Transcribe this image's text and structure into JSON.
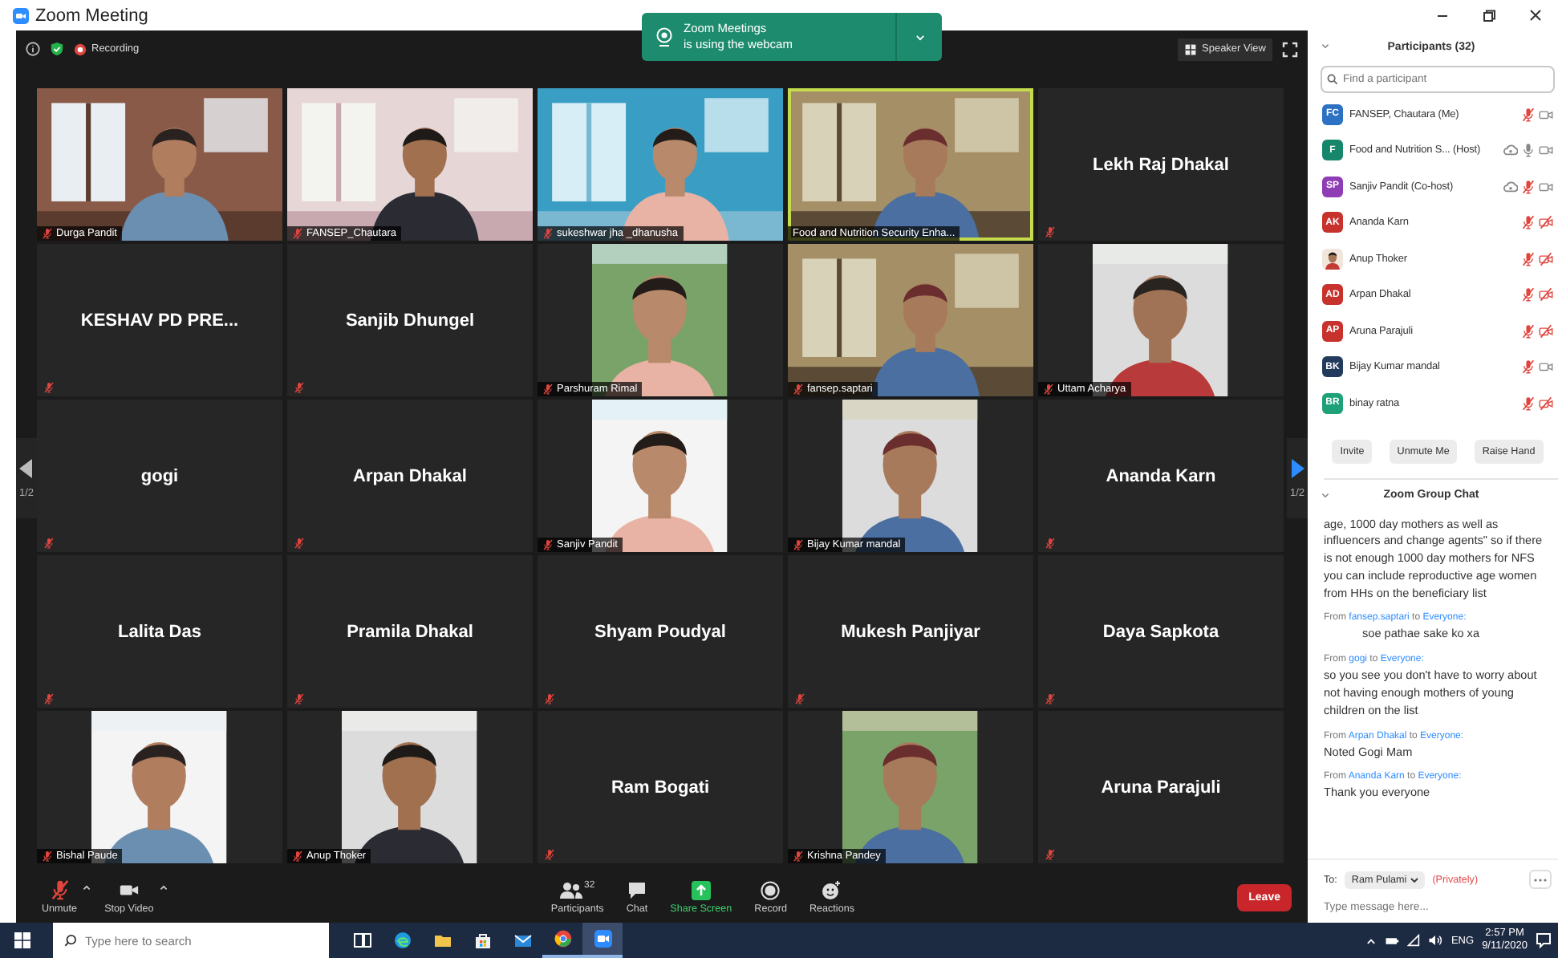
{
  "window": {
    "title": "Zoom Meeting"
  },
  "meeting_bar": {
    "recording": "Recording",
    "view_button": "Speaker View"
  },
  "notification": {
    "title": "Zoom Meetings",
    "message": "is using the webcam"
  },
  "pager": {
    "prev_label": "1/2",
    "next_label": "1/2"
  },
  "tiles": [
    {
      "kind": "video",
      "name": "Durga Pandit",
      "muted": true,
      "speaking": false
    },
    {
      "kind": "video",
      "name": "FANSEP_Chautara",
      "muted": true,
      "speaking": false
    },
    {
      "kind": "video",
      "name": "sukeshwar jha _dhanusha",
      "muted": true,
      "speaking": false
    },
    {
      "kind": "video",
      "name": "Food and Nutrition Security Enha...",
      "muted": false,
      "speaking": true
    },
    {
      "kind": "name",
      "name": "Lekh Raj Dhakal",
      "muted": true,
      "speaking": false
    },
    {
      "kind": "name",
      "name": "KESHAV PD PRE...",
      "muted": true,
      "speaking": false
    },
    {
      "kind": "name",
      "name": "Sanjib Dhungel",
      "muted": true,
      "speaking": false
    },
    {
      "kind": "portrait",
      "name": "Parshuram Rimal",
      "muted": true,
      "speaking": false
    },
    {
      "kind": "video",
      "name": "fansep.saptari",
      "muted": true,
      "speaking": false
    },
    {
      "kind": "portrait",
      "name": "Uttam Acharya",
      "muted": true,
      "speaking": false
    },
    {
      "kind": "name",
      "name": "gogi",
      "muted": true,
      "speaking": false
    },
    {
      "kind": "name",
      "name": "Arpan Dhakal",
      "muted": true,
      "speaking": false
    },
    {
      "kind": "portrait",
      "name": "Sanjiv Pandit",
      "muted": true,
      "speaking": false
    },
    {
      "kind": "portrait",
      "name": "Bijay Kumar mandal",
      "muted": true,
      "speaking": false
    },
    {
      "kind": "name",
      "name": "Ananda Karn",
      "muted": true,
      "speaking": false
    },
    {
      "kind": "name",
      "name": "Lalita Das",
      "muted": true,
      "speaking": false
    },
    {
      "kind": "name",
      "name": "Pramila Dhakal",
      "muted": true,
      "speaking": false
    },
    {
      "kind": "name",
      "name": "Shyam Poudyal",
      "muted": true,
      "speaking": false
    },
    {
      "kind": "name",
      "name": "Mukesh Panjiyar",
      "muted": true,
      "speaking": false
    },
    {
      "kind": "name",
      "name": "Daya Sapkota",
      "muted": true,
      "speaking": false
    },
    {
      "kind": "portrait",
      "name": "Bishal Paude",
      "muted": true,
      "speaking": false
    },
    {
      "kind": "portrait",
      "name": "Anup Thoker",
      "muted": true,
      "speaking": false
    },
    {
      "kind": "name",
      "name": "Ram Bogati",
      "muted": true,
      "speaking": false
    },
    {
      "kind": "portrait",
      "name": "Krishna Pandey",
      "muted": true,
      "speaking": false
    },
    {
      "kind": "name",
      "name": "Aruna Parajuli",
      "muted": true,
      "speaking": false
    }
  ],
  "toolbar": {
    "items": [
      {
        "kind": "mic-muted",
        "label": "Unmute",
        "caret": true
      },
      {
        "kind": "camera",
        "label": "Stop Video",
        "caret": true
      },
      {
        "kind": "participants",
        "label": "Participants",
        "count": "32",
        "caret": false
      },
      {
        "kind": "chat",
        "label": "Chat",
        "caret": false
      },
      {
        "kind": "share",
        "label": "Share Screen",
        "caret": false
      },
      {
        "kind": "record",
        "label": "Record",
        "caret": false
      },
      {
        "kind": "reactions",
        "label": "Reactions",
        "caret": false
      }
    ],
    "leave": "Leave"
  },
  "participants": {
    "title": "Participants (32)",
    "search_placeholder": "Find a participant",
    "people": [
      {
        "kind": "initials",
        "initials": "FC",
        "color": "#2d72c2",
        "name": "FANSEP, Chautara (Me)",
        "recording": false,
        "muted": true,
        "video": true
      },
      {
        "kind": "initials",
        "initials": "F",
        "color": "#17876c",
        "name": "Food and Nutrition S... (Host)",
        "recording": true,
        "muted": false,
        "video": true
      },
      {
        "kind": "initials",
        "initials": "SP",
        "color": "#8e3db4",
        "name": "Sanjiv Pandit (Co-host)",
        "recording": true,
        "muted": true,
        "video": true
      },
      {
        "kind": "initials",
        "initials": "AK",
        "color": "#c8322d",
        "name": "Ananda Karn",
        "recording": false,
        "muted": true,
        "video": false
      },
      {
        "name": "Anup Thoker",
        "recording": false,
        "muted": true,
        "video": false
      },
      {
        "kind": "initials",
        "initials": "AD",
        "color": "#c8322d",
        "name": "Arpan Dhakal",
        "recording": false,
        "muted": true,
        "video": false
      },
      {
        "kind": "initials",
        "initials": "AP",
        "color": "#c8322d",
        "name": "Aruna Parajuli",
        "recording": false,
        "muted": true,
        "video": false
      },
      {
        "kind": "initials",
        "initials": "BK",
        "color": "#233a5c",
        "name": "Bijay Kumar mandal",
        "recording": false,
        "muted": true,
        "video": true
      },
      {
        "kind": "initials",
        "initials": "BR",
        "color": "#1ea079",
        "name": "binay ratna",
        "recording": false,
        "muted": true,
        "video": false
      }
    ],
    "buttons": [
      "Invite",
      "Unmute Me",
      "Raise Hand"
    ]
  },
  "chat": {
    "title": "Zoom Group Chat",
    "messages": [
      {
        "kind": "continuation",
        "text": "age, 1000 day mothers as well as influencers and change agents\" so if there is not enough 1000 day mothers for NFS you can include reproductive age women from HHs on the beneficiary list"
      },
      {
        "kind": "message",
        "from_label": "From",
        "sender": "fansep.saptari",
        "to_label": "to",
        "recipient": "Everyone:",
        "text": "soe pathae sake ko xa",
        "indented": true
      },
      {
        "kind": "message",
        "from_label": "From",
        "sender": "gogi",
        "to_label": "to",
        "recipient": "Everyone:",
        "text": "so you see you don't have to worry about not having enough mothers of young children on the list",
        "indented": false
      },
      {
        "kind": "message",
        "from_label": "From",
        "sender": "Arpan Dhakal",
        "to_label": "to",
        "recipient": "Everyone:",
        "text": "Noted Gogi Mam",
        "indented": false
      },
      {
        "kind": "message",
        "from_label": "From",
        "sender": "Ananda Karn",
        "to_label": "to",
        "recipient": "Everyone:",
        "text": "Thank you everyone",
        "indented": false
      }
    ],
    "to_label": "To:",
    "recipient": "Ram Pulami",
    "privacy": "(Privately)",
    "placeholder": "Type message here..."
  },
  "taskbar": {
    "search_placeholder": "Type here to search",
    "apps": [
      {
        "kind": "task-view",
        "running": false,
        "selected": false
      },
      {
        "kind": "browser-swirl",
        "running": false,
        "selected": false
      },
      {
        "kind": "folder",
        "running": false,
        "selected": false
      },
      {
        "kind": "store",
        "running": false,
        "selected": false
      },
      {
        "kind": "mail",
        "running": false,
        "selected": false
      },
      {
        "kind": "browser-circle",
        "running": true,
        "selected": false
      },
      {
        "kind": "video-app",
        "running": true,
        "selected": true
      }
    ],
    "language": "ENG",
    "time": "2:57 PM",
    "date": "9/11/2020"
  }
}
